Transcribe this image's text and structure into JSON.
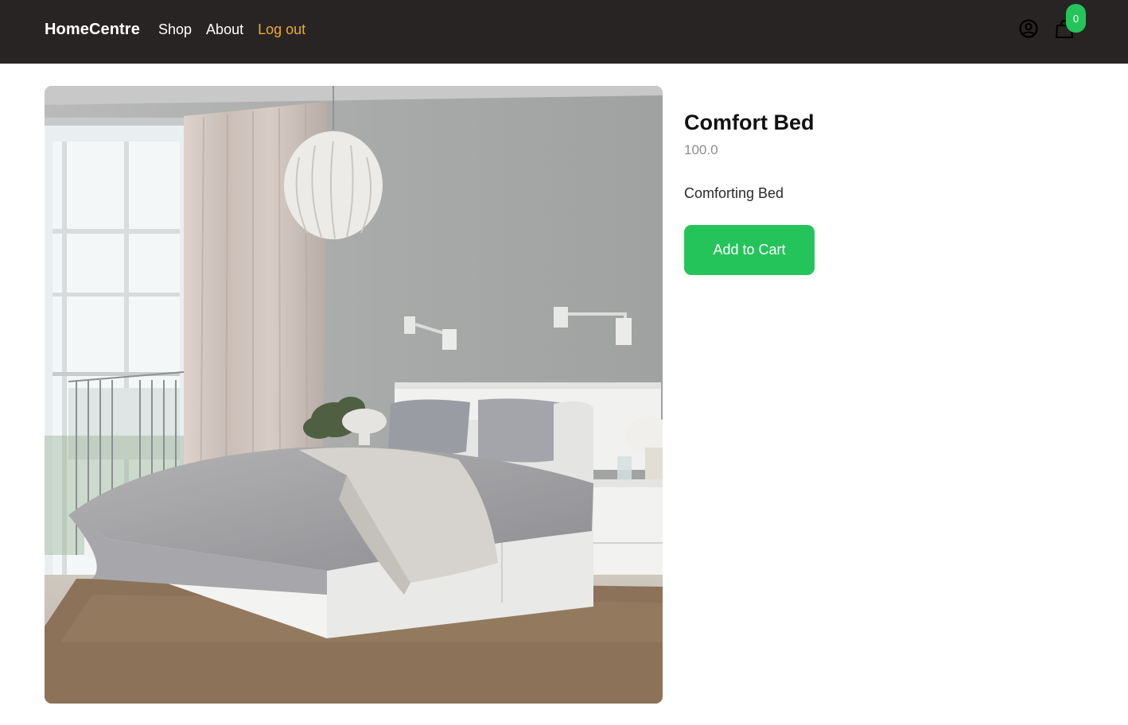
{
  "header": {
    "brand": "HomeCentre",
    "nav": [
      {
        "label": "Shop"
      },
      {
        "label": "About"
      },
      {
        "label": "Log out"
      }
    ],
    "account_icon": "user-circle-icon",
    "cart_icon": "shopping-bag-icon",
    "cart_count": "0"
  },
  "product": {
    "title": "Comfort Bed",
    "price": "100.0",
    "description": "Comforting Bed",
    "add_to_cart_label": "Add to Cart",
    "image_alt": "Comfort Bed"
  },
  "colors": {
    "header_bg": "#282423",
    "accent_green": "#24c45a",
    "logout_link": "#f0a92a"
  }
}
